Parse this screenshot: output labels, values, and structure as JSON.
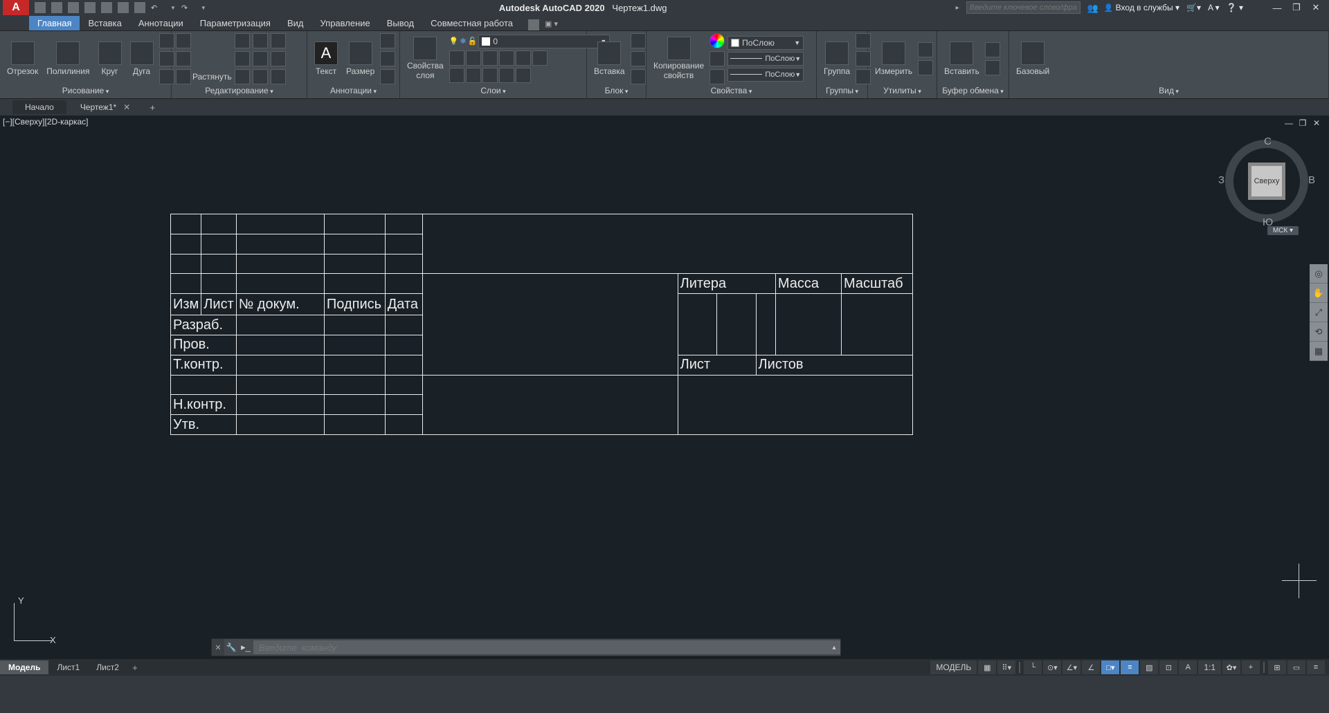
{
  "title": {
    "app": "Autodesk AutoCAD 2020",
    "file": "Чертеж1.dwg"
  },
  "qat": {
    "undo": "↶",
    "redo": "↷"
  },
  "search": {
    "placeholder": "Введите ключевое слово/фразу"
  },
  "account": {
    "login": "Вход в службы ▾"
  },
  "tabs": [
    "Главная",
    "Вставка",
    "Аннотации",
    "Параметризация",
    "Вид",
    "Управление",
    "Вывод",
    "Совместная работа"
  ],
  "ribbon": {
    "draw": {
      "title": "Рисование",
      "line": "Отрезок",
      "pline": "Полилиния",
      "circle": "Круг",
      "arc": "Дуга"
    },
    "modify": {
      "title": "Редактирование",
      "stretch": "Растянуть"
    },
    "annot": {
      "title": "Аннотации",
      "text": "Текст",
      "dim": "Размер"
    },
    "layers": {
      "title": "Слои",
      "props": "Свойства\nслоя",
      "current": "0"
    },
    "block": {
      "title": "Блок",
      "insert": "Вставка"
    },
    "props": {
      "title": "Свойства",
      "match": "Копирование\nсвойств",
      "bylayer": "ПоСлою"
    },
    "groups": {
      "title": "Группы",
      "group": "Группа"
    },
    "utils": {
      "title": "Утилиты",
      "measure": "Измерить"
    },
    "clip": {
      "title": "Буфер обмена",
      "paste": "Вставить"
    },
    "view": {
      "title": "Вид",
      "base": "Базовый"
    }
  },
  "filetabs": {
    "start": "Начало",
    "active": "Чертеж1*"
  },
  "viewport": {
    "label": "[−][Сверху][2D-каркас]"
  },
  "viewcube": {
    "face": "Сверху",
    "n": "С",
    "s": "Ю",
    "e": "В",
    "w": "З",
    "wcs": "МСК ▾"
  },
  "ucs": {
    "y": "Y",
    "x": "X"
  },
  "cmd": {
    "placeholder": "Введите  команду"
  },
  "layouts": {
    "model": "Модель",
    "l1": "Лист1",
    "l2": "Лист2"
  },
  "status": {
    "model": "МОДЕЛЬ",
    "scale": "1:1"
  },
  "stamp": {
    "h_izm": "Изм",
    "h_list": "Лист",
    "h_docnum": "№ докум.",
    "h_sign": "Подпись",
    "h_date": "Дата",
    "razrab": "Разраб.",
    "prov": "Пров.",
    "tkontr": "Т.контр.",
    "nkontr": "Н.контр.",
    "utv": "Утв.",
    "litera": "Литера",
    "massa": "Масса",
    "masstab": "Масштаб",
    "list": "Лист",
    "listov": "Листов"
  }
}
